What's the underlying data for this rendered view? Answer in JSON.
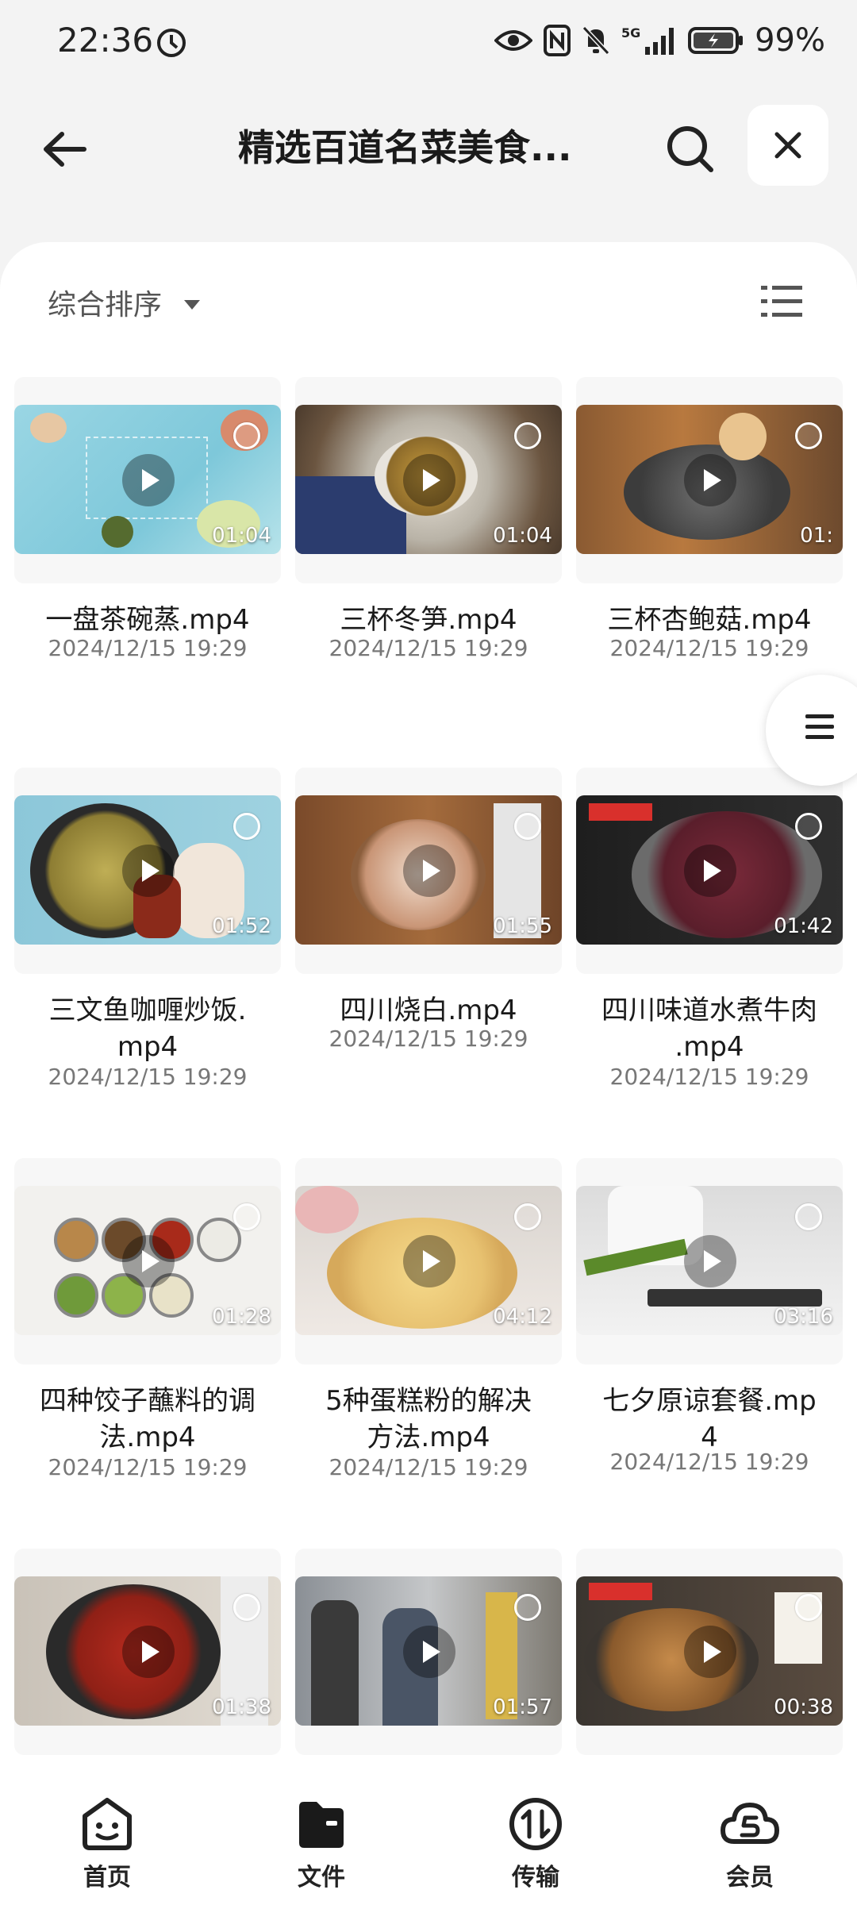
{
  "status": {
    "time": "22:36",
    "network": "5G",
    "battery": "99%"
  },
  "header": {
    "title": "精选百道名菜美食..."
  },
  "sort": {
    "label": "综合排序"
  },
  "videos": [
    {
      "name": "一盘茶碗蒸.mp4",
      "date": "2024/12/15 19:29",
      "duration": "01:04"
    },
    {
      "name": "三杯冬笋.mp4",
      "date": "2024/12/15 19:29",
      "duration": "01:04"
    },
    {
      "name": "三杯杏鲍菇.mp4",
      "date": "2024/12/15 19:29",
      "duration": "01:"
    },
    {
      "name_line1": "三文鱼咖喱炒饭.",
      "name_line2": "mp4",
      "date": "2024/12/15 19:29",
      "duration": "01:52"
    },
    {
      "name": "四川烧白.mp4",
      "date": "2024/12/15 19:29",
      "duration": "01:55"
    },
    {
      "name_line1": "四川味道水煮牛肉",
      "name_line2": ".mp4",
      "date": "2024/12/15 19:29",
      "duration": "01:42"
    },
    {
      "name_line1": "四种饺子蘸料的调",
      "name_line2": "法.mp4",
      "date": "2024/12/15 19:29",
      "duration": "01:28"
    },
    {
      "name_line1": "5种蛋糕粉的解决",
      "name_line2": "方法.mp4",
      "date": "2024/12/15 19:29",
      "duration": "04:12"
    },
    {
      "name_line1": "七夕原谅套餐.mp",
      "name_line2": "4",
      "date": "2024/12/15 19:29",
      "duration": "03:16"
    },
    {
      "duration": "01:38"
    },
    {
      "duration": "01:57"
    },
    {
      "duration": "00:38"
    }
  ],
  "nav": [
    {
      "label": "首页",
      "icon": "home-smile-icon"
    },
    {
      "label": "文件",
      "icon": "folder-icon"
    },
    {
      "label": "传输",
      "icon": "transfer-icon"
    },
    {
      "label": "会员",
      "icon": "cloud-member-icon"
    }
  ]
}
